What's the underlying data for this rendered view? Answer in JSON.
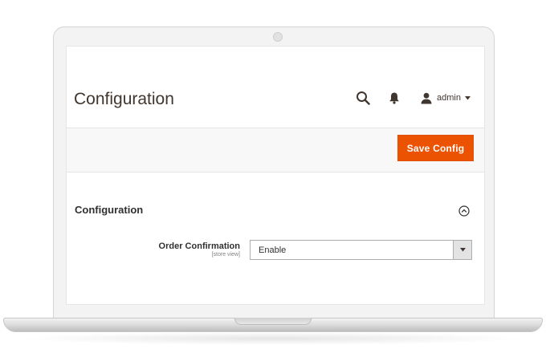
{
  "header": {
    "title": "Configuration",
    "icons": {
      "search": "search-icon",
      "notifications": "bell-icon",
      "user": "user-icon"
    },
    "user_name": "admin"
  },
  "toolbar": {
    "save_label": "Save Config"
  },
  "section": {
    "title": "Configuration",
    "collapse_icon": "collapse-up-icon"
  },
  "field": {
    "label": "Order Confirmation",
    "scope": "[store view]",
    "value": "Enable"
  },
  "colors": {
    "accent": "#eb5202",
    "text": "#41362f",
    "action_bar_bg": "#f8f8f8"
  }
}
